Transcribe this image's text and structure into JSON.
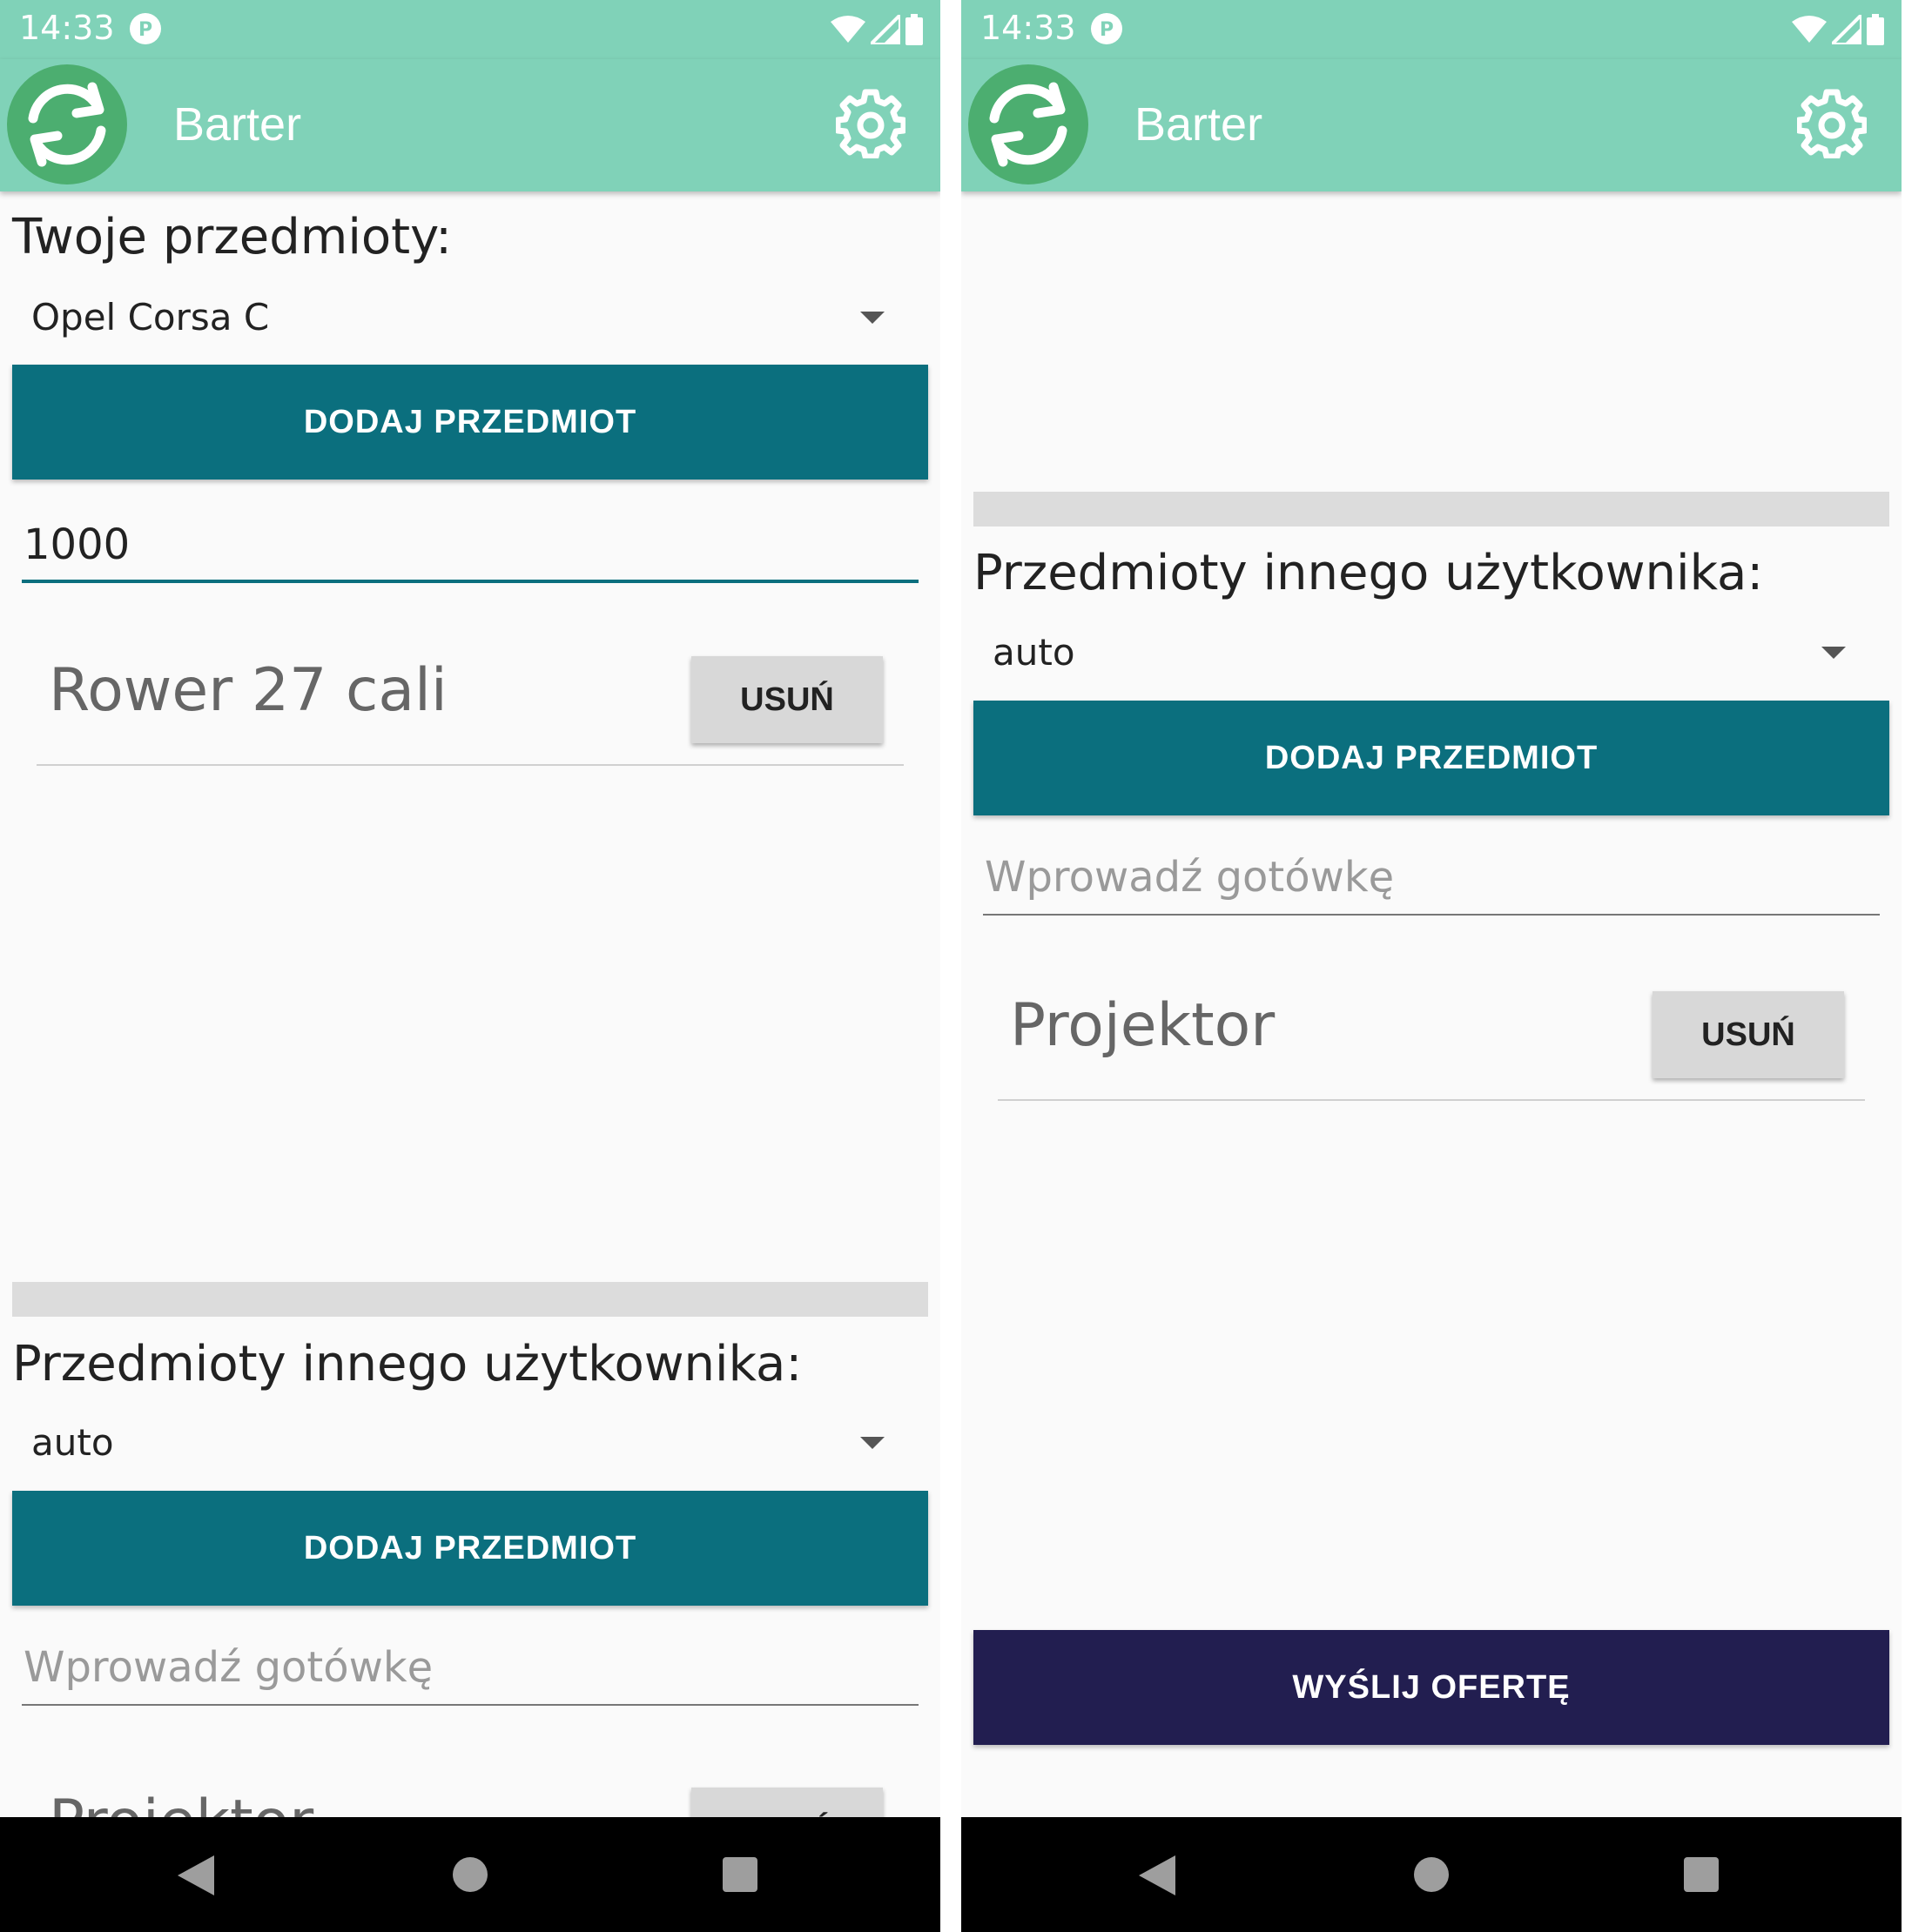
{
  "colors": {
    "app_bar": "#80d2b8",
    "button_primary": "#0b6f7e",
    "button_send": "#221e50",
    "button_remove": "#d8d8d8",
    "field_active_underline": "#0b6f7e"
  },
  "left": {
    "status": {
      "time": "14:33",
      "icons": [
        "app-notification-icon",
        "wifi-icon",
        "signal-icon",
        "battery-icon"
      ]
    },
    "app_bar": {
      "title": "Barter",
      "logo_icon": "sync-icon",
      "settings_icon": "gear-icon"
    },
    "my_items": {
      "label": "Twoje przedmioty:",
      "spinner_value": "Opel Corsa C",
      "add_button": "DODAJ PRZEDMIOT",
      "cash_value": "1000",
      "items": [
        {
          "name": "Rower 27 cali",
          "remove": "USUŃ"
        }
      ]
    },
    "other_items": {
      "label": "Przedmioty innego użytkownika:",
      "spinner_value": "auto",
      "add_button": "DODAJ PRZEDMIOT",
      "cash_placeholder": "Wprowadź gotówkę",
      "items": [
        {
          "name": "Projektor",
          "remove": "USUŃ"
        }
      ]
    },
    "nav": [
      "back-icon",
      "home-icon",
      "recents-icon"
    ]
  },
  "right": {
    "status": {
      "time": "14:33"
    },
    "app_bar": {
      "title": "Barter"
    },
    "other_items": {
      "label": "Przedmioty innego użytkownika:",
      "spinner_value": "auto",
      "add_button": "DODAJ PRZEDMIOT",
      "cash_placeholder": "Wprowadź gotówkę",
      "items": [
        {
          "name": "Projektor",
          "remove": "USUŃ"
        }
      ]
    },
    "send_button": "WYŚLIJ OFERTĘ"
  }
}
